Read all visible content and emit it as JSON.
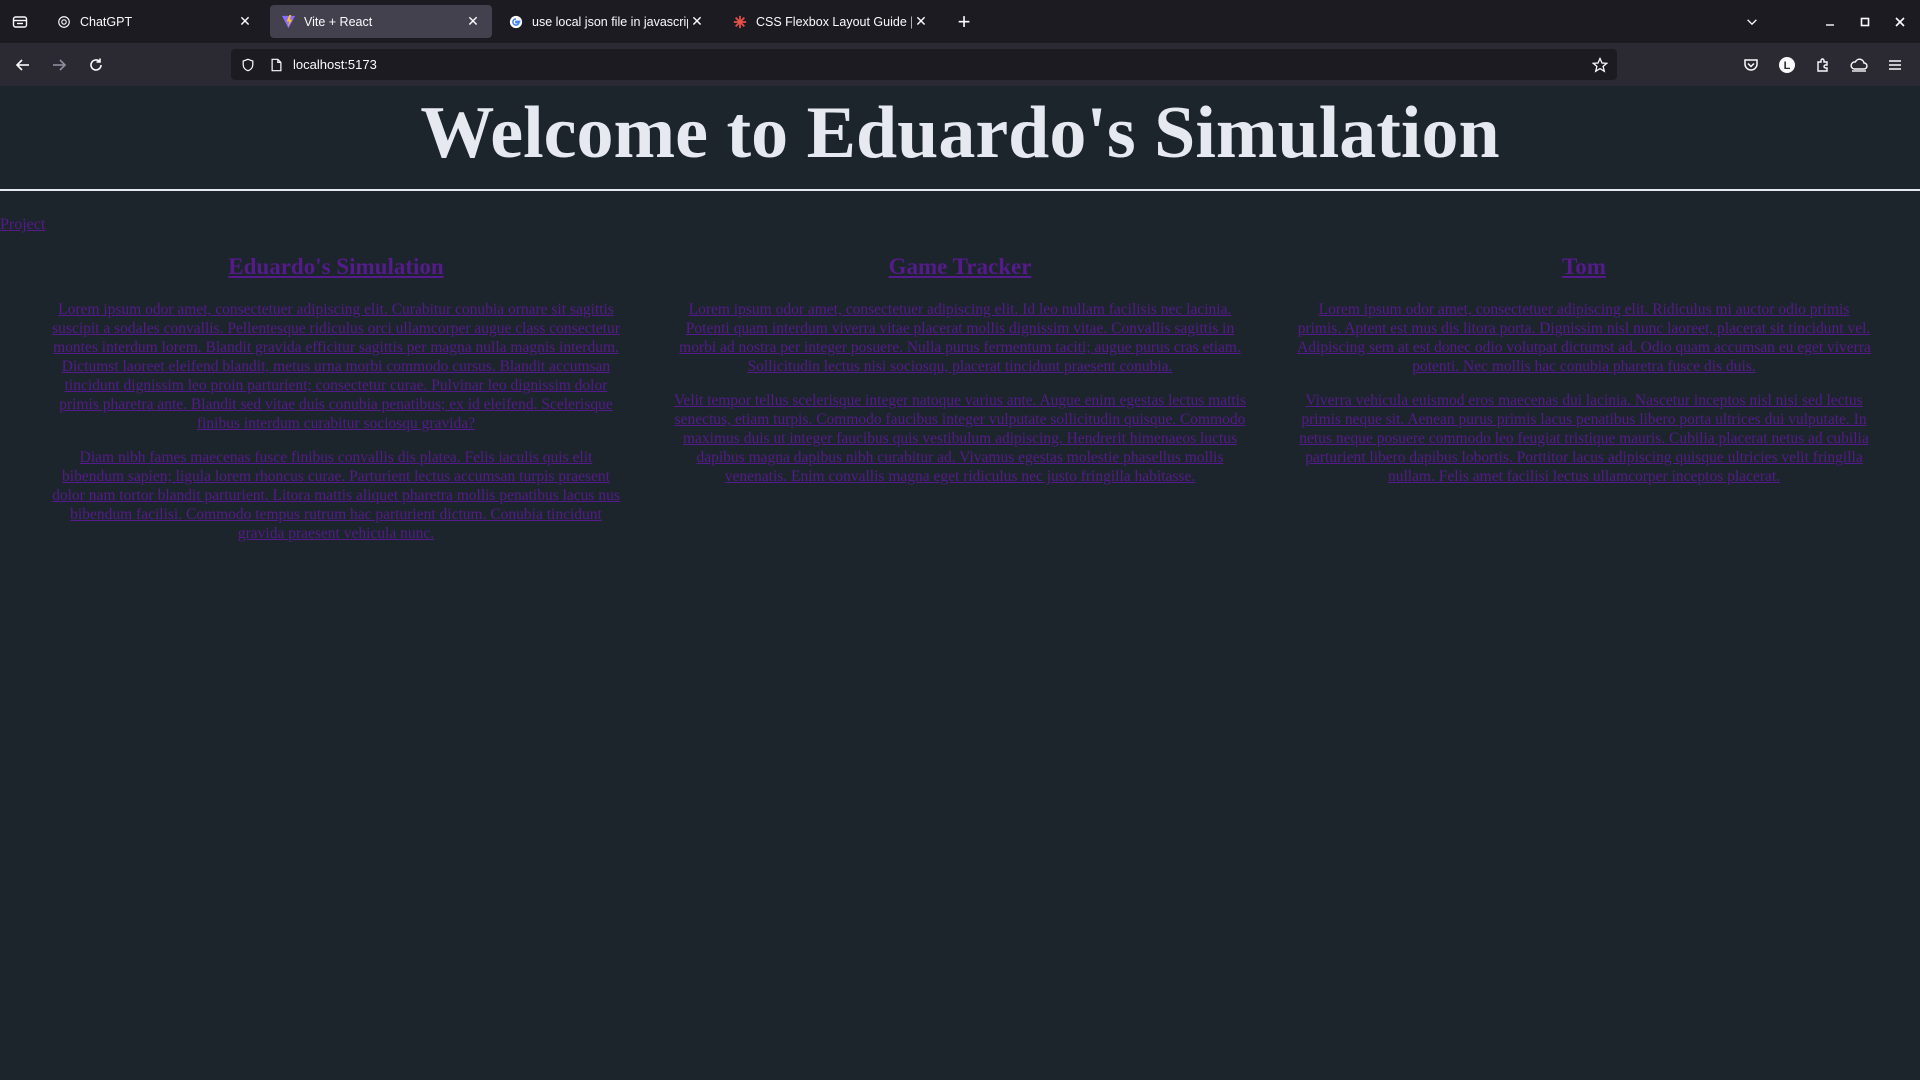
{
  "browser": {
    "tabs": [
      {
        "title": "ChatGPT",
        "icon": "chatgpt-icon",
        "active": false
      },
      {
        "title": "Vite + React",
        "icon": "vite-icon",
        "active": true
      },
      {
        "title": "use local json file in javascript - G",
        "icon": "google-icon",
        "active": false
      },
      {
        "title": "CSS Flexbox Layout Guide | CS",
        "icon": "css-tricks-icon",
        "active": false
      }
    ],
    "url": "localhost:5173"
  },
  "page": {
    "heading": "Welcome to Eduardo's Simulation",
    "nav_link": "Project",
    "projects": [
      {
        "title": "Eduardo's Simulation",
        "paragraphs": [
          "Lorem ipsum odor amet, consectetuer adipiscing elit. Curabitur conubia ornare sit sagittis suscipit a sodales convallis. Pellentesque ridiculus orci ullamcorper augue class consectetur montes interdum lorem. Blandit gravida efficitur sagittis per magna nulla magnis interdum. Dictumst laoreet eleifend blandit, metus urna morbi commodo cursus. Blandit accumsan tincidunt dignissim leo proin parturient; consectetur curae. Pulvinar leo dignissim dolor primis pharetra ante. Blandit sed vitae duis conubia penatibus; ex id eleifend. Scelerisque finibus interdum curabitur sociosqu gravida?",
          "Diam nibh fames maecenas fusce finibus convallis dis platea. Felis iaculis quis elit bibendum sapien; ligula lorem rhoncus curae. Parturient lectus accumsan turpis praesent dolor nam tortor blandit parturient. Litora mattis aliquet pharetra mollis penatibus lacus nus bibendum facilisi. Commodo tempus rutrum hac parturient dictum. Conubia tincidunt gravida praesent vehicula nunc."
        ]
      },
      {
        "title": "Game Tracker",
        "paragraphs": [
          "Lorem ipsum odor amet, consectetuer adipiscing elit. Id leo nullam facilisis nec lacinia. Potenti quam interdum viverra vitae placerat mollis dignissim vitae. Convallis sagittis in morbi ad nostra per integer posuere. Nulla purus fermentum taciti; augue purus cras etiam. Sollicitudin lectus nisi sociosqu, placerat tincidunt praesent conubia.",
          "Velit tempor tellus scelerisque integer natoque varius ante. Augue enim egestas lectus mattis senectus, etiam turpis. Commodo faucibus integer vulputate sollicitudin quisque. Commodo maximus duis ut integer faucibus quis vestibulum adipiscing. Hendrerit himenaeos luctus dapibus magna dapibus nibh curabitur ad. Vivamus egestas molestie phasellus mollis venenatis. Enim convallis magna eget ridiculus nec justo fringilla habitasse."
        ]
      },
      {
        "title": "Tom",
        "paragraphs": [
          "Lorem ipsum odor amet, consectetuer adipiscing elit. Ridiculus mi auctor odio primis primis. Aptent est mus dis litora porta. Dignissim nisl nunc laoreet, placerat sit tincidunt vel. Adipiscing sem at est donec odio volutpat dictumst ad. Odio quam accumsan eu eget viverra potenti. Nec mollis hac conubia pharetra fusce dis duis.",
          "Viverra vehicula euismod eros maecenas dui lacinia. Nascetur inceptos nisl nisi sed lectus primis neque sit. Aenean purus primis lacus penatibus libero porta ultrices dui vulputate. In netus neque posuere commodo leo feugiat tristique mauris. Cubilia placerat netus ad cubilia parturient libero dapibus lobortis. Porttitor lacus adipiscing quisque ultricies velit fringilla nullam. Felis amet facilisi lectus ullamcorper inceptos placerat."
        ]
      }
    ]
  },
  "colors": {
    "page_bg": "#1c252b",
    "heading": "#e6e9f0",
    "link_visited": "#551a8b"
  }
}
